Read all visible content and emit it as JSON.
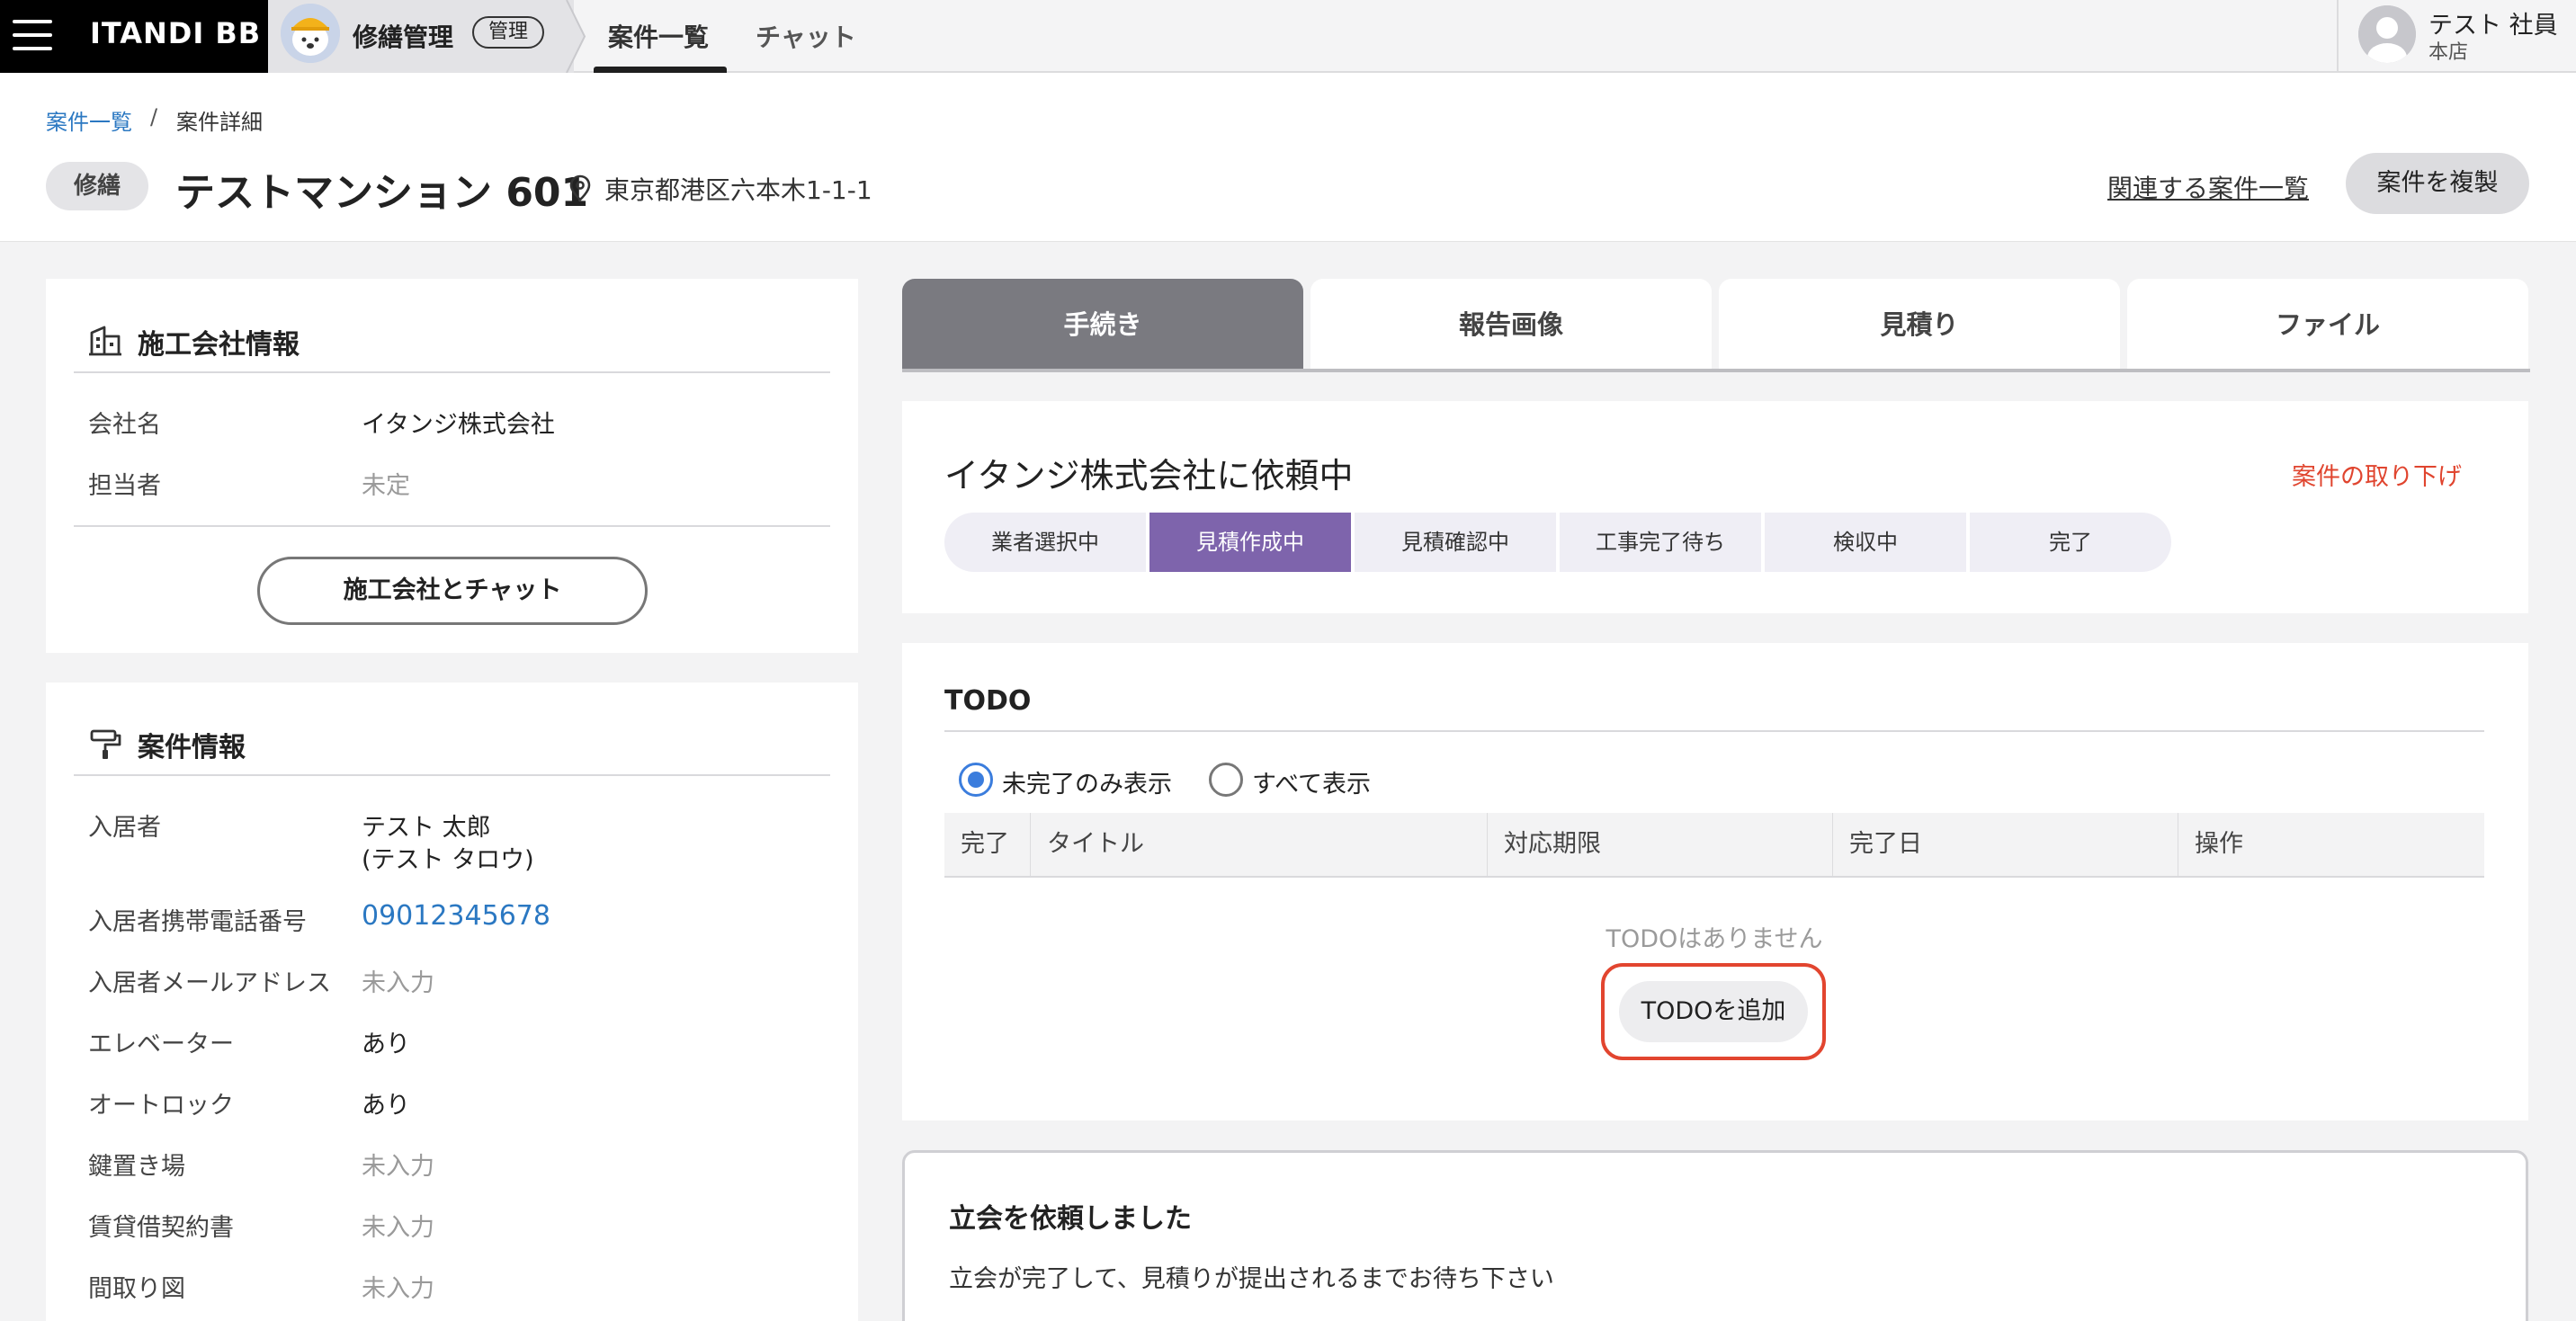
{
  "nav": {
    "brand": "ITANDI BB",
    "app_title": "修繕管理",
    "admin_badge": "管理",
    "tabs": [
      "案件一覧",
      "チャット"
    ],
    "user_name": "テスト 社員",
    "user_branch": "本店"
  },
  "header": {
    "breadcrumb": {
      "link": "案件一覧",
      "separator": "/",
      "current": "案件詳細"
    },
    "type_badge": "修繕",
    "title": "テストマンション 601",
    "address": "東京都港区六本木1-1-1",
    "related_link": "関連する案件一覧",
    "duplicate_button": "案件を複製"
  },
  "company_card": {
    "title": "施工会社情報",
    "fields": [
      {
        "label": "会社名",
        "value": "イタンジ株式会社"
      },
      {
        "label": "担当者",
        "value": "未定"
      }
    ],
    "chat_button": "施工会社とチャット"
  },
  "case_card": {
    "title": "案件情報",
    "fields": [
      {
        "label": "入居者",
        "value": "テスト 太郎",
        "value2": "(テスト タロウ)"
      },
      {
        "label": "入居者携帯電話番号",
        "value": "09012345678"
      },
      {
        "label": "入居者メールアドレス",
        "value": "未入力"
      },
      {
        "label": "エレベーター",
        "value": "あり"
      },
      {
        "label": "オートロック",
        "value": "あり"
      },
      {
        "label": "鍵置き場",
        "value": "未入力"
      },
      {
        "label": "賃貸借契約書",
        "value": "未入力"
      },
      {
        "label": "間取り図",
        "value": "未入力"
      }
    ]
  },
  "tabs": [
    "手続き",
    "報告画像",
    "見積り",
    "ファイル"
  ],
  "status": {
    "title": "イタンジ株式会社に依頼中",
    "withdraw": "案件の取り下げ",
    "steps": [
      "業者選択中",
      "見積作成中",
      "見積確認中",
      "工事完了待ち",
      "検収中",
      "完了"
    ]
  },
  "todo": {
    "title": "TODO",
    "filters": [
      "未完了のみ表示",
      "すべて表示"
    ],
    "columns": [
      "完了",
      "タイトル",
      "対応期限",
      "完了日",
      "操作"
    ],
    "empty": "TODOはありません",
    "add_button": "TODOを追加"
  },
  "notice": {
    "title": "立会を依頼しました",
    "body": "立会が完了して、見積りが提出されるまでお待ち下さい"
  },
  "colors": {
    "accent_purple": "#7e64ac",
    "link_blue": "#2b78c2",
    "danger_red": "#e0452f",
    "radio_blue": "#3b7ddd"
  }
}
